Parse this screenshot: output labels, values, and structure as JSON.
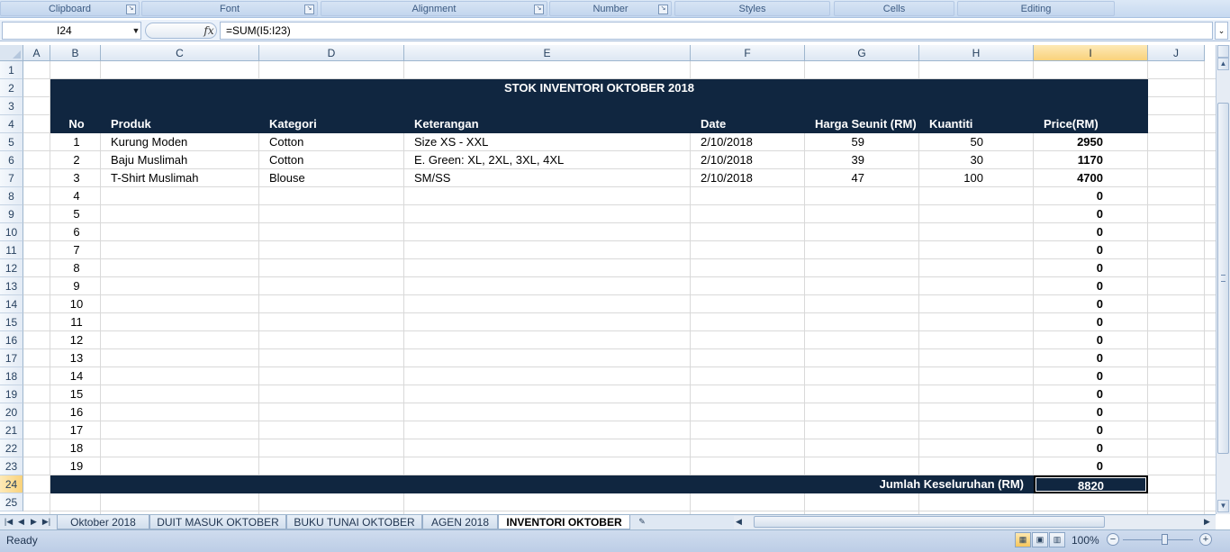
{
  "ribbon": {
    "groups": [
      "Clipboard",
      "Font",
      "Alignment",
      "Number",
      "Styles",
      "Cells",
      "Editing"
    ]
  },
  "formula_bar": {
    "name_box": "I24",
    "fx_label": "fx",
    "formula": "=SUM(I5:I23)"
  },
  "columns": [
    "A",
    "B",
    "C",
    "D",
    "E",
    "F",
    "G",
    "H",
    "I",
    "J"
  ],
  "selected_column": "I",
  "rows": [
    "1",
    "2",
    "3",
    "4",
    "5",
    "6",
    "7",
    "8",
    "9",
    "10",
    "11",
    "12",
    "13",
    "14",
    "15",
    "16",
    "17",
    "18",
    "19",
    "20",
    "21",
    "22",
    "23",
    "24",
    "25"
  ],
  "selected_row": "24",
  "sheet": {
    "title": "STOK INVENTORI OKTOBER 2018",
    "headers": {
      "no": "No",
      "produk": "Produk",
      "kategori": "Kategori",
      "keterangan": "Keterangan",
      "date": "Date",
      "harga": "Harga Seunit (RM)",
      "kuantiti": "Kuantiti",
      "price": "Price(RM)"
    },
    "items": [
      {
        "no": "1",
        "produk": "Kurung Moden",
        "kategori": "Cotton",
        "keterangan": "Size XS - XXL",
        "date": "2/10/2018",
        "harga": "59",
        "kuantiti": "50",
        "price": "2950"
      },
      {
        "no": "2",
        "produk": "Baju Muslimah",
        "kategori": "Cotton",
        "keterangan": "E. Green: XL, 2XL, 3XL, 4XL",
        "date": "2/10/2018",
        "harga": "39",
        "kuantiti": "30",
        "price": "1170"
      },
      {
        "no": "3",
        "produk": "T-Shirt Muslimah",
        "kategori": "Blouse",
        "keterangan": "SM/SS",
        "date": "2/10/2018",
        "harga": "47",
        "kuantiti": "100",
        "price": "4700"
      },
      {
        "no": "4",
        "price": "0"
      },
      {
        "no": "5",
        "price": "0"
      },
      {
        "no": "6",
        "price": "0"
      },
      {
        "no": "7",
        "price": "0"
      },
      {
        "no": "8",
        "price": "0"
      },
      {
        "no": "9",
        "price": "0"
      },
      {
        "no": "10",
        "price": "0"
      },
      {
        "no": "11",
        "price": "0"
      },
      {
        "no": "12",
        "price": "0"
      },
      {
        "no": "13",
        "price": "0"
      },
      {
        "no": "14",
        "price": "0"
      },
      {
        "no": "15",
        "price": "0"
      },
      {
        "no": "16",
        "price": "0"
      },
      {
        "no": "17",
        "price": "0"
      },
      {
        "no": "18",
        "price": "0"
      },
      {
        "no": "19",
        "price": "0"
      }
    ],
    "total_label": "Jumlah Keseluruhan (RM)",
    "total_value": "8820"
  },
  "sheet_tabs": [
    {
      "label": "Oktober 2018",
      "active": false
    },
    {
      "label": "DUIT MASUK OKTOBER",
      "active": false
    },
    {
      "label": "BUKU TUNAI OKTOBER",
      "active": false
    },
    {
      "label": "AGEN 2018",
      "active": false
    },
    {
      "label": "INVENTORI OKTOBER",
      "active": true
    }
  ],
  "status_bar": {
    "status": "Ready",
    "zoom": "100%"
  },
  "colors": {
    "band": "#102640",
    "selection_header": "#f9d27b"
  }
}
